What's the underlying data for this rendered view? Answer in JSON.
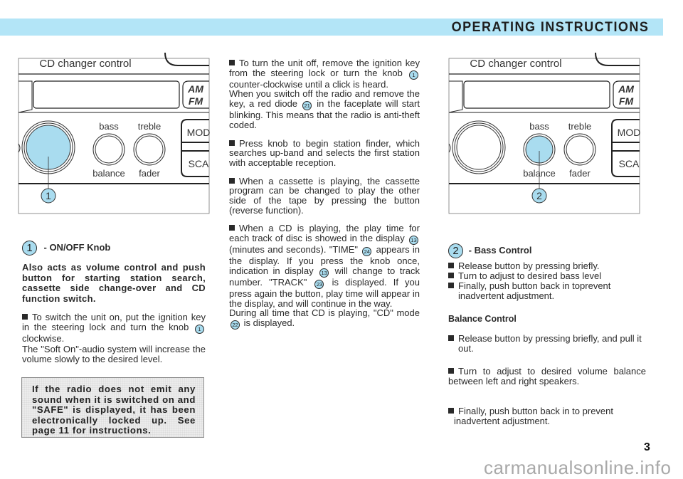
{
  "header": {
    "title": "OPERATING INSTRUCTIONS",
    "band_color": "#b3e5f7"
  },
  "diagram_left": {
    "top_label": "CD changer control",
    "band_label": "AM\nFM",
    "am_label": "AM",
    "fm_label": "FM",
    "knob_labels": {
      "bass": "bass",
      "treble": "treble",
      "balance": "balance",
      "fader": "fader"
    },
    "side_buttons": [
      "MOD",
      "SCA"
    ],
    "callout": "1",
    "highlighted": "main-knob",
    "highlight_color": "#a9dcef"
  },
  "diagram_right": {
    "top_label": "CD changer control",
    "am_label": "AM",
    "fm_label": "FM",
    "knob_labels": {
      "bass": "bass",
      "treble": "treble",
      "balance": "balance",
      "fader": "fader"
    },
    "side_buttons": [
      "MOD",
      "SCA"
    ],
    "callout": "2",
    "highlighted": "bass-knob",
    "highlight_color": "#a9dcef"
  },
  "left_column": {
    "section_number": "1",
    "section_title": "- ON/OFF Knob",
    "intro": "Also acts as volume control and push button for starting station search, cassette side change-over and CD function switch.",
    "para1_a": "To switch the unit on, put the ignition key in the steering lock and turn the knob",
    "para1_ref": "1",
    "para1_b": "clockwise.",
    "para1_c": "The \"Soft On\"-audio system will increase the volume slowly to the desired level.",
    "warning": "If the radio does not emit any sound when it is switched on and \"SAFE\" is displayed, it has been electronically locked up. See page 11 for instructions."
  },
  "middle_column": {
    "p1_a": "To turn the unit off, remove the ignition key from the steering lock or turn the knob",
    "p1_ref": "1",
    "p1_b": "counter-clockwise until a click is heard.",
    "p1_c": "When you switch off the radio and remove the key, a red diode",
    "p1_ref2": "21",
    "p1_d": "in the faceplate will start blinking. This means that the radio is anti-theft coded.",
    "p2": "Press knob to begin station finder, which searches up-band and selects the first station with acceptable reception.",
    "p3": "When a cassette is playing, the cassette program can be changed to play the other side of the tape by pressing the button (reverse function).",
    "p4_a": "When a CD is playing, the play time for each track of disc is showed in the display",
    "p4_ref1": "13",
    "p4_b": "(minutes and seconds). \"TIME\"",
    "p4_ref2": "24",
    "p4_c": "appears in the display. If you press the knob once, indication in display",
    "p4_ref3": "13",
    "p4_d": "will change to track number. \"TRACK\"",
    "p4_ref4": "23",
    "p4_e": "is displayed. If you press again the button, play time will appear in the display, and will continue in the way.",
    "p4_f": "During all time that CD is playing, \"CD\" mode",
    "p4_ref5": "22",
    "p4_g": "is displayed."
  },
  "right_column": {
    "section_number": "2",
    "section_title": "- Bass Control",
    "bass_items": [
      "Release button by pressing briefly.",
      "Turn to adjust to desired bass level",
      "Finally, push button back in toprevent inadvertent adjustment."
    ],
    "balance_title": "Balance Control",
    "balance_items": [
      "Release button by pressing briefly, and pull it out.",
      "Turn to adjust to desired volume balance between left and right speakers.",
      "Finally, push button back in to prevent inadvertent adjustment."
    ]
  },
  "footer": {
    "page_number": "3",
    "watermark": "carmanualsonline.info"
  }
}
